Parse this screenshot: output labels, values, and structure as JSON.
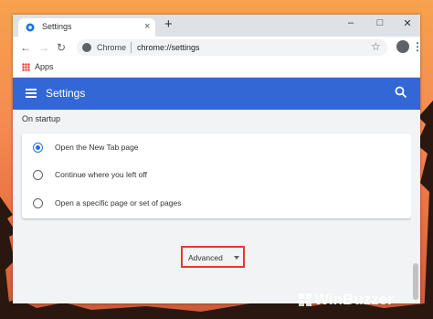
{
  "browser": {
    "tab_title": "Settings",
    "new_tab_symbol": "+",
    "tab_close_symbol": "×",
    "window_controls": {
      "minimize": "–",
      "maximize": "□",
      "close": "✕"
    },
    "site_name": "Chrome",
    "url": "chrome://settings",
    "bookmarks": {
      "apps_label": "Apps"
    },
    "icons": [
      "back-icon",
      "forward-icon",
      "reload-icon",
      "star-icon",
      "profile-icon",
      "menu-icon"
    ]
  },
  "app": {
    "title": "Settings",
    "accent": "#3367d6"
  },
  "on_startup": {
    "title": "On startup",
    "options": [
      {
        "label": "Open the New Tab page",
        "selected": true
      },
      {
        "label": "Continue where you left off",
        "selected": false
      },
      {
        "label": "Open a specific page or set of pages",
        "selected": false
      }
    ]
  },
  "advanced": {
    "label": "Advanced",
    "highlight": "#e53935"
  },
  "watermark": {
    "text": "WinBuzzer"
  }
}
